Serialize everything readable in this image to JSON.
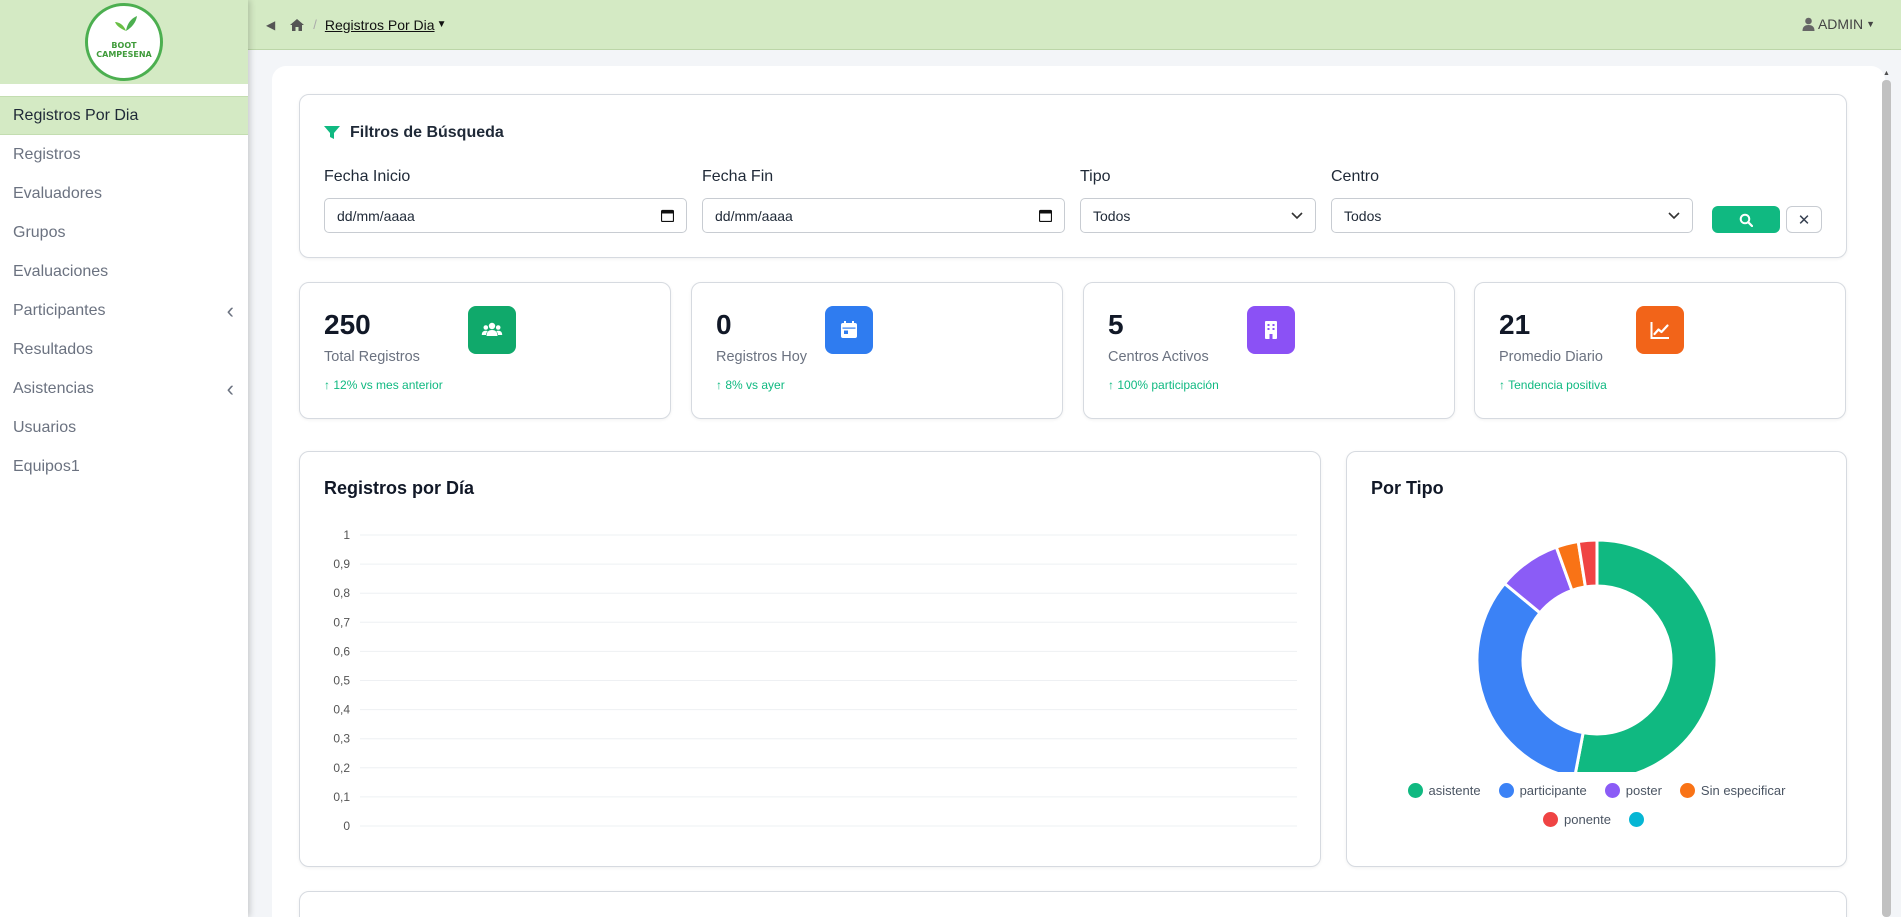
{
  "logo": {
    "line1": "BOOT",
    "line2": "CAMPESENA"
  },
  "sidebar": {
    "items": [
      {
        "label": "Registros Por Dia",
        "active": true,
        "chevron": false
      },
      {
        "label": "Registros",
        "active": false,
        "chevron": false
      },
      {
        "label": "Evaluadores",
        "active": false,
        "chevron": false
      },
      {
        "label": "Grupos",
        "active": false,
        "chevron": false
      },
      {
        "label": "Evaluaciones",
        "active": false,
        "chevron": false
      },
      {
        "label": "Participantes",
        "active": false,
        "chevron": true
      },
      {
        "label": "Resultados",
        "active": false,
        "chevron": false
      },
      {
        "label": "Asistencias",
        "active": false,
        "chevron": true
      },
      {
        "label": "Usuarios",
        "active": false,
        "chevron": false
      },
      {
        "label": "Equipos1",
        "active": false,
        "chevron": false
      }
    ]
  },
  "topbar": {
    "breadcrumb": "Registros Por Dia",
    "user": "ADMIN"
  },
  "filters": {
    "title": "Filtros de Búsqueda",
    "fecha_inicio": {
      "label": "Fecha Inicio",
      "value": "dd/mm/aaaa"
    },
    "fecha_fin": {
      "label": "Fecha Fin",
      "value": "dd/mm/aaaa"
    },
    "tipo": {
      "label": "Tipo",
      "value": "Todos"
    },
    "centro": {
      "label": "Centro",
      "value": "Todos"
    }
  },
  "stats": [
    {
      "value": "250",
      "label": "Total Registros",
      "trend": "12% vs mes anterior",
      "color": "#10a96b",
      "icon": "users-icon"
    },
    {
      "value": "0",
      "label": "Registros Hoy",
      "trend": "8% vs ayer",
      "color": "#2f7cf0",
      "icon": "calendar-icon"
    },
    {
      "value": "5",
      "label": "Centros Activos",
      "trend": "100% participación",
      "color": "#8b51f5",
      "icon": "building-icon"
    },
    {
      "value": "21",
      "label": "Promedio Diario",
      "trend": "Tendencia positiva",
      "color": "#f26419",
      "icon": "chart-line-icon"
    }
  ],
  "colors": {
    "accent": "#10b981",
    "header_bg": "#d4eac4"
  },
  "chart_data": [
    {
      "type": "line",
      "title": "Registros por Día",
      "x": [],
      "series": [],
      "ylim": [
        0,
        1
      ],
      "yticks": [
        "0",
        "0,1",
        "0,2",
        "0,3",
        "0,4",
        "0,5",
        "0,6",
        "0,7",
        "0,8",
        "0,9",
        "1"
      ],
      "grid": true
    },
    {
      "type": "pie",
      "title": "Por Tipo",
      "legend_position": "bottom",
      "slices": [
        {
          "name": "asistente",
          "value": 0.53,
          "color": "#10b981"
        },
        {
          "name": "participante",
          "value": 0.33,
          "color": "#3b82f6"
        },
        {
          "name": "poster",
          "value": 0.085,
          "color": "#8b5cf6"
        },
        {
          "name": "Sin especificar",
          "value": 0.03,
          "color": "#f97316"
        },
        {
          "name": "ponente",
          "value": 0.025,
          "color": "#ef4444"
        },
        {
          "name": "",
          "value": 0,
          "color": "#06b6d4"
        }
      ]
    }
  ]
}
